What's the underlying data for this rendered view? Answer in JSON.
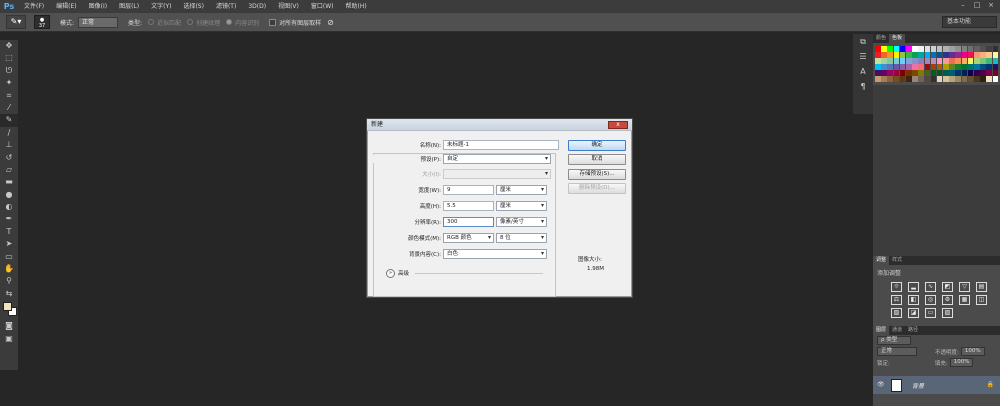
{
  "app": {
    "logo": "Ps"
  },
  "menu": [
    "文件(F)",
    "编辑(E)",
    "图像(I)",
    "图层(L)",
    "文字(Y)",
    "选择(S)",
    "滤镜(T)",
    "3D(D)",
    "视图(V)",
    "窗口(W)",
    "帮助(H)"
  ],
  "window_controls": [
    "–",
    "□",
    "×"
  ],
  "options": {
    "brush_size": "37",
    "mode_label": "模式:",
    "mode_value": "正常",
    "type_label": "类型:",
    "type_options": [
      "近似匹配",
      "创建纹理",
      "内容识别"
    ],
    "sample_all_layers": "对所有图层取样",
    "workspace": "基本功能"
  },
  "right_panels": {
    "swatch_tabs": [
      "颜色",
      "色板"
    ],
    "adjust_tabs": [
      "调整",
      "样式"
    ],
    "adjust_title": "添加调整",
    "layers_tabs": [
      "图层",
      "通道",
      "路径"
    ],
    "layer_kind": "ρ 类型",
    "blend_mode": "正常",
    "opacity_label": "不透明度:",
    "opacity_value": "100%",
    "lock_label": "锁定:",
    "fill_label": "填充:",
    "fill_value": "100%",
    "layer_name": "背景"
  },
  "swatch_colors": [
    "#ff0000",
    "#ffff00",
    "#00ff00",
    "#00ffff",
    "#0000ff",
    "#ff00ff",
    "#ffffff",
    "#f0f0f0",
    "#e0e0e0",
    "#d0d0d0",
    "#c0c0c0",
    "#b0b0b0",
    "#a0a0a0",
    "#909090",
    "#808080",
    "#707070",
    "#606060",
    "#505050",
    "#404040",
    "#303030",
    "#ed1c24",
    "#f26522",
    "#f7941d",
    "#fff200",
    "#8dc63f",
    "#39b54a",
    "#00a651",
    "#00a99d",
    "#00aeef",
    "#0072bc",
    "#0054a6",
    "#2e3192",
    "#662d91",
    "#92278f",
    "#ec008c",
    "#ed145b",
    "#f69679",
    "#f9ad81",
    "#fdc68a",
    "#fff79a",
    "#c4df9b",
    "#a3d39c",
    "#82ca9c",
    "#7accc8",
    "#6dcff6",
    "#7da7d9",
    "#8393ca",
    "#8781bd",
    "#a186be",
    "#bd8cbf",
    "#f49ac2",
    "#f6989d",
    "#f26c4f",
    "#f68e56",
    "#fbaf5d",
    "#fff467",
    "#acd373",
    "#7cc576",
    "#3cb878",
    "#1cbbb4",
    "#00bff3",
    "#448ccb",
    "#5674b9",
    "#605ca8",
    "#855fa8",
    "#a763a8",
    "#f06eaa",
    "#f26d7d",
    "#9e0b0f",
    "#a0410d",
    "#a36209",
    "#aba000",
    "#598527",
    "#197b30",
    "#007236",
    "#00746b",
    "#0076a3",
    "#004b80",
    "#003471",
    "#1b1464",
    "#440e62",
    "#630460",
    "#9e005d",
    "#9e0039",
    "#790000",
    "#7b2e00",
    "#7d4900",
    "#827b00",
    "#406618",
    "#005e20",
    "#005826",
    "#005952",
    "#005b7f",
    "#003663",
    "#002157",
    "#0d004c",
    "#32004b",
    "#4b0049",
    "#7b0046",
    "#7a0026",
    "#c69c6d",
    "#a67c52",
    "#8c6239",
    "#754c24",
    "#603913",
    "#3c2415",
    "#998675",
    "#736357",
    "#534741",
    "#362f2d",
    "#e6d5b8",
    "#d4c19c",
    "#b8a47a",
    "#9c8860",
    "#806c48",
    "#645032",
    "#483820",
    "#2c200e",
    "#efe4bf",
    "#ffffff"
  ],
  "dialog": {
    "title": "新建",
    "close": "x",
    "name_label": "名称(N):",
    "name_value": "未标题-1",
    "preset_label": "预设(P):",
    "preset_value": "自定",
    "size_label": "大小(I):",
    "width_label": "宽度(W):",
    "width_value": "9",
    "width_unit": "厘米",
    "height_label": "高度(H):",
    "height_value": "5.5",
    "height_unit": "厘米",
    "resolution_label": "分辨率(R):",
    "resolution_value": "300",
    "resolution_unit": "像素/英寸",
    "color_mode_label": "颜色模式(M):",
    "color_mode_value": "RGB 颜色",
    "bit_depth": "8 位",
    "background_label": "背景内容(C):",
    "background_value": "白色",
    "advanced_label": "高级",
    "ok": "确定",
    "cancel": "取消",
    "save_preset": "存储预设(S)...",
    "delete_preset": "删除预设(D)...",
    "image_size_label": "图像大小:",
    "image_size_value": "1.98M"
  }
}
